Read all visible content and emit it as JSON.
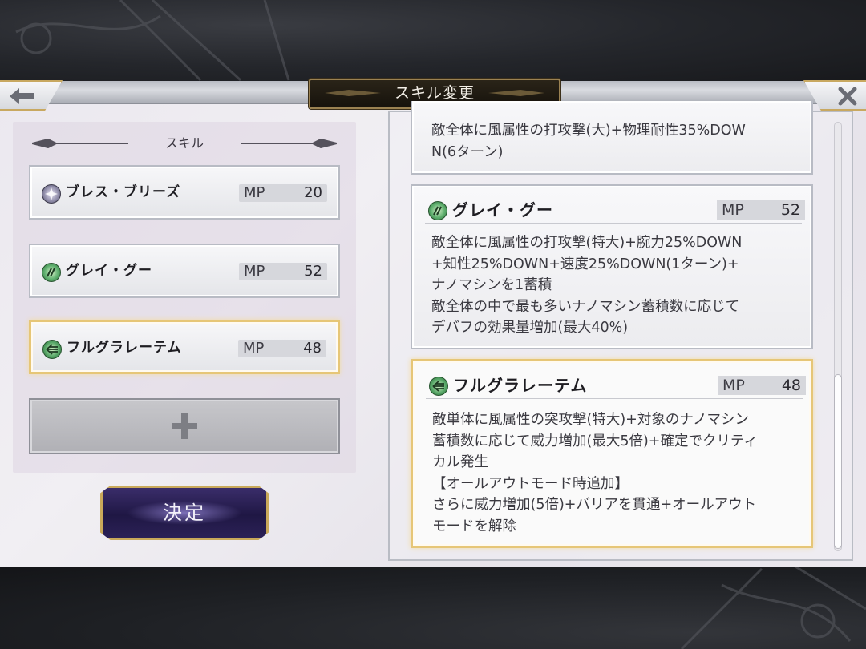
{
  "header": {
    "title": "スキル変更"
  },
  "left": {
    "section_label": "スキル",
    "mp_label": "MP",
    "slots": [
      {
        "name": "ブレス・ブリーズ",
        "mp": "20",
        "icon": "star-icon"
      },
      {
        "name": "グレイ・グー",
        "mp": "52",
        "icon": "wind-icon"
      },
      {
        "name": "フルグラレーテム",
        "mp": "48",
        "icon": "arrow-icon",
        "selected": true
      }
    ],
    "decide_label": "決定"
  },
  "detail": {
    "mp_label": "MP",
    "cards": [
      {
        "name": "",
        "mp": "",
        "desc": "敵全体に風属性の打攻撃(大)+物理耐性35%DOW\nN(6ターン)"
      },
      {
        "name": "グレイ・グー",
        "mp": "52",
        "icon": "wind-icon",
        "desc": "敵全体に風属性の打攻撃(特大)+腕力25%DOWN\n+知性25%DOWN+速度25%DOWN(1ターン)+\nナノマシンを1蓄積\n敵全体の中で最も多いナノマシン蓄積数に応じて\nデバフの効果量増加(最大40%)"
      },
      {
        "name": "フルグラレーテム",
        "mp": "48",
        "icon": "arrow-icon",
        "desc": "敵単体に風属性の突攻撃(特大)+対象のナノマシン\n蓄積数に応じて威力増加(最大5倍)+確定でクリティ\nカル発生\n【オールアウトモード時追加】\nさらに威力増加(5倍)+バリアを貫通+オールアウト\nモードを解除"
      }
    ]
  },
  "colors": {
    "gold_border": "#e6c677",
    "button_purple": "#2b2156"
  }
}
